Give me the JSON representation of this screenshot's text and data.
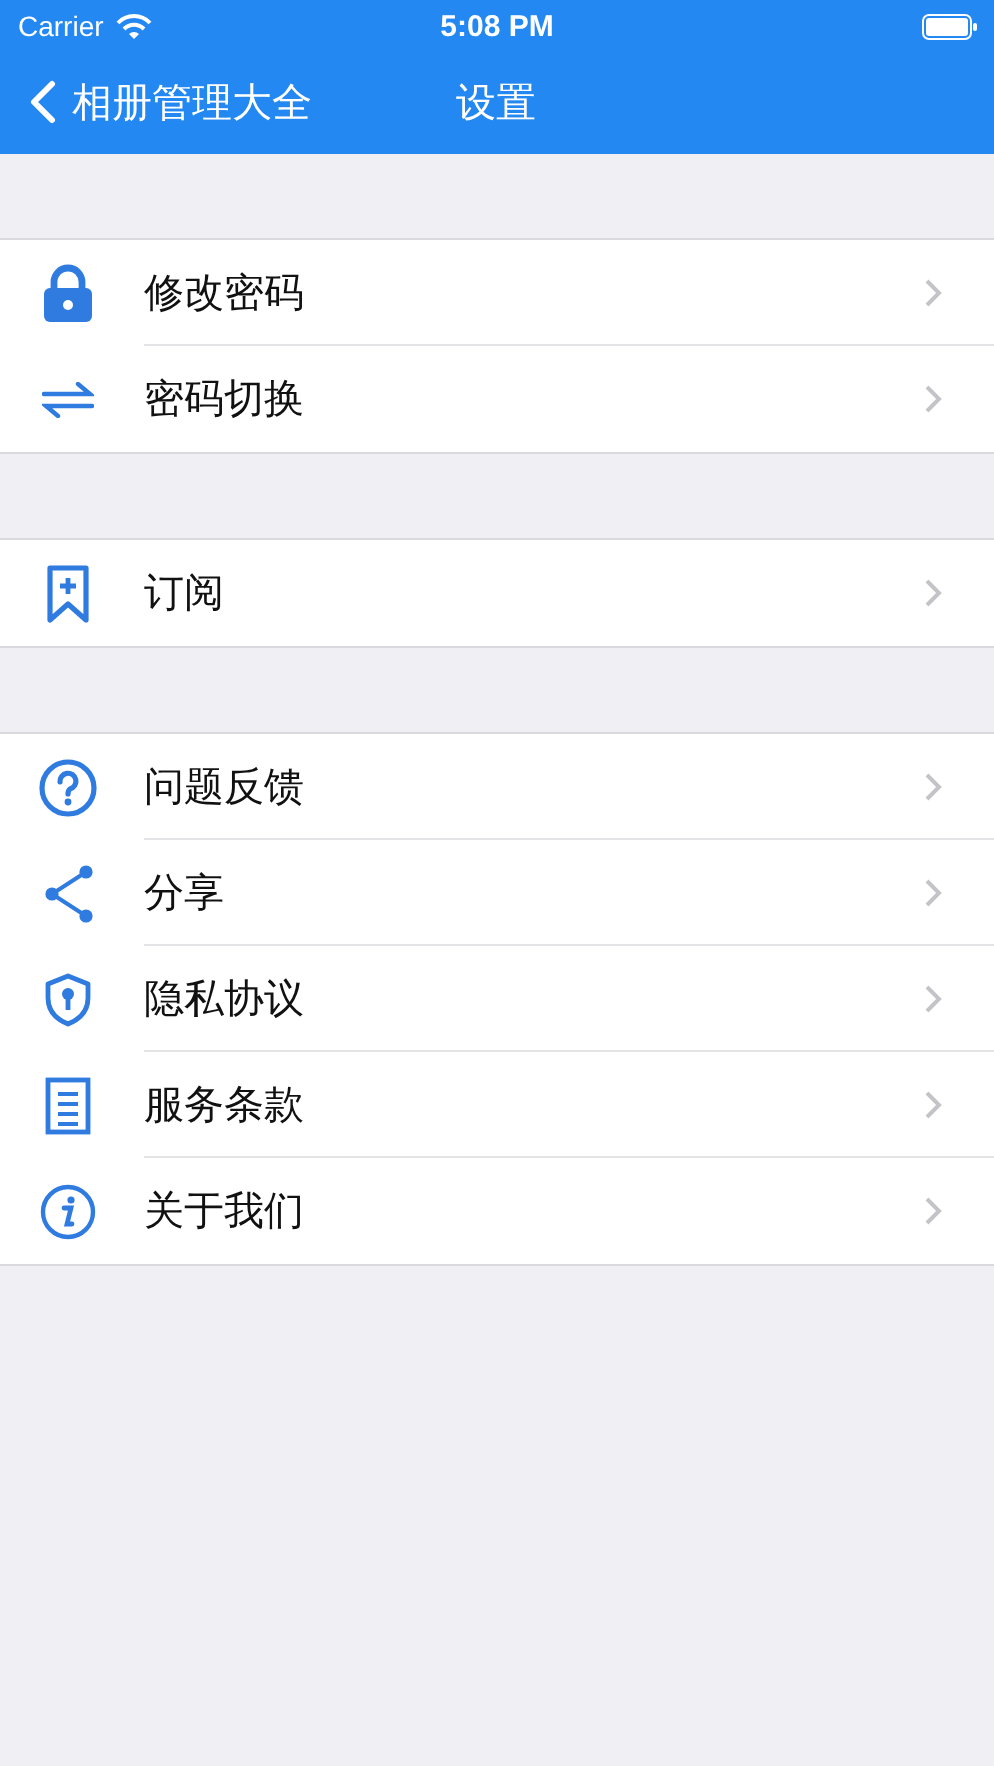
{
  "status_bar": {
    "carrier": "Carrier",
    "time": "5:08 PM"
  },
  "nav_bar": {
    "back_label": "相册管理大全",
    "title": "设置"
  },
  "sections": [
    {
      "rows": [
        {
          "label": "修改密码"
        },
        {
          "label": "密码切换"
        }
      ]
    },
    {
      "rows": [
        {
          "label": "订阅"
        }
      ]
    },
    {
      "rows": [
        {
          "label": "问题反馈"
        },
        {
          "label": "分享"
        },
        {
          "label": "隐私协议"
        },
        {
          "label": "服务条款"
        },
        {
          "label": "关于我们"
        }
      ]
    }
  ]
}
